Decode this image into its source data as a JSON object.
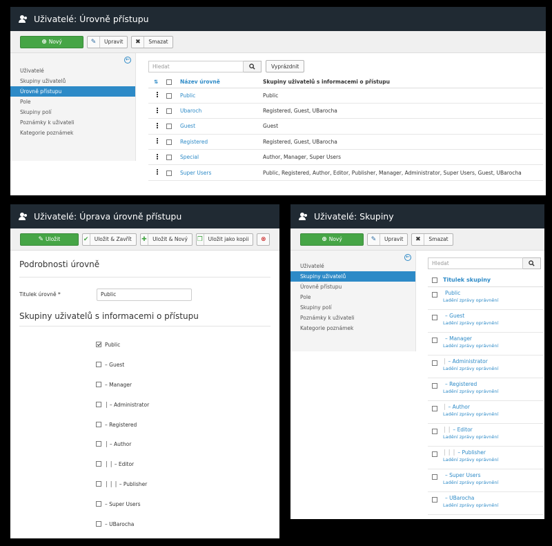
{
  "panel1": {
    "title": "Uživatelé: Úrovně přístupu",
    "toolbar": {
      "new": "Nový",
      "edit": "Upravit",
      "delete": "Smazat"
    },
    "sidebar": [
      "Uživatelé",
      "Skupiny uživatelů",
      "Úrovně přístupu",
      "Pole",
      "Skupiny polí",
      "Poznámky k uživateli",
      "Kategorie poznámek"
    ],
    "active_index": 2,
    "search_placeholder": "Hledat",
    "clear_label": "Vyprázdnit",
    "columns": [
      "Název úrovně",
      "Skupiny uživatelů s informacemi o přístupu"
    ],
    "rows": [
      {
        "name": "Public",
        "groups": "Public"
      },
      {
        "name": "Ubaroch",
        "groups": "Registered, Guest, UBarocha"
      },
      {
        "name": "Guest",
        "groups": "Guest"
      },
      {
        "name": "Registered",
        "groups": "Registered, Guest, UBarocha"
      },
      {
        "name": "Special",
        "groups": "Author, Manager, Super Users"
      },
      {
        "name": "Super Users",
        "groups": "Public, Registered, Author, Editor, Publisher, Manager, Administrator, Super Users, Guest, UBarocha"
      }
    ]
  },
  "panel2": {
    "title": "Uživatelé: Úprava úrovně přístupu",
    "toolbar": {
      "save": "Uložit",
      "save_close": "Uložit & Zavřít",
      "save_new": "Uložit & Nový",
      "save_copy": "Uložit jako kopii"
    },
    "details_heading": "Podrobnosti úrovně",
    "title_label": "Titulek úrovně *",
    "title_value": "Public",
    "groups_heading": "Skupiny uživatelů s informacemi o přístupu",
    "groups": [
      {
        "label": "Public",
        "checked": true
      },
      {
        "label": "– Guest",
        "checked": false
      },
      {
        "label": "– Manager",
        "checked": false
      },
      {
        "label": "│ – Administrator",
        "checked": false
      },
      {
        "label": "– Registered",
        "checked": false
      },
      {
        "label": "│ – Author",
        "checked": false
      },
      {
        "label": "│ │ – Editor",
        "checked": false
      },
      {
        "label": "│ │ │ – Publisher",
        "checked": false
      },
      {
        "label": "– Super Users",
        "checked": false
      },
      {
        "label": "– UBarocha",
        "checked": false
      }
    ]
  },
  "panel3": {
    "title": "Uživatelé: Skupiny",
    "toolbar": {
      "new": "Nový",
      "edit": "Upravit",
      "delete": "Smazat"
    },
    "sidebar": [
      "Uživatelé",
      "Skupiny uživatelů",
      "Úrovně přístupu",
      "Pole",
      "Skupiny polí",
      "Poznámky k uživateli",
      "Kategorie poznámek"
    ],
    "active_index": 1,
    "search_placeholder": "Hledat",
    "column": "Titulek skupiny",
    "debug_label": "Ladění zprávy oprávnění",
    "rows": [
      {
        "pipes": "",
        "name": "Public",
        "dash": false
      },
      {
        "pipes": "",
        "name": "Guest",
        "dash": true
      },
      {
        "pipes": "",
        "name": "Manager",
        "dash": true
      },
      {
        "pipes": "│",
        "name": "Administrator",
        "dash": true
      },
      {
        "pipes": "",
        "name": "Registered",
        "dash": true
      },
      {
        "pipes": "│",
        "name": "Author",
        "dash": true
      },
      {
        "pipes": "│ │",
        "name": "Editor",
        "dash": true
      },
      {
        "pipes": "│ │ │",
        "name": "Publisher",
        "dash": true
      },
      {
        "pipes": "",
        "name": "Super Users",
        "dash": true
      },
      {
        "pipes": "",
        "name": "UBarocha",
        "dash": true
      }
    ]
  },
  "colors": {
    "header": "#202a33",
    "accent": "#2d8ac7",
    "green": "#46a546"
  }
}
